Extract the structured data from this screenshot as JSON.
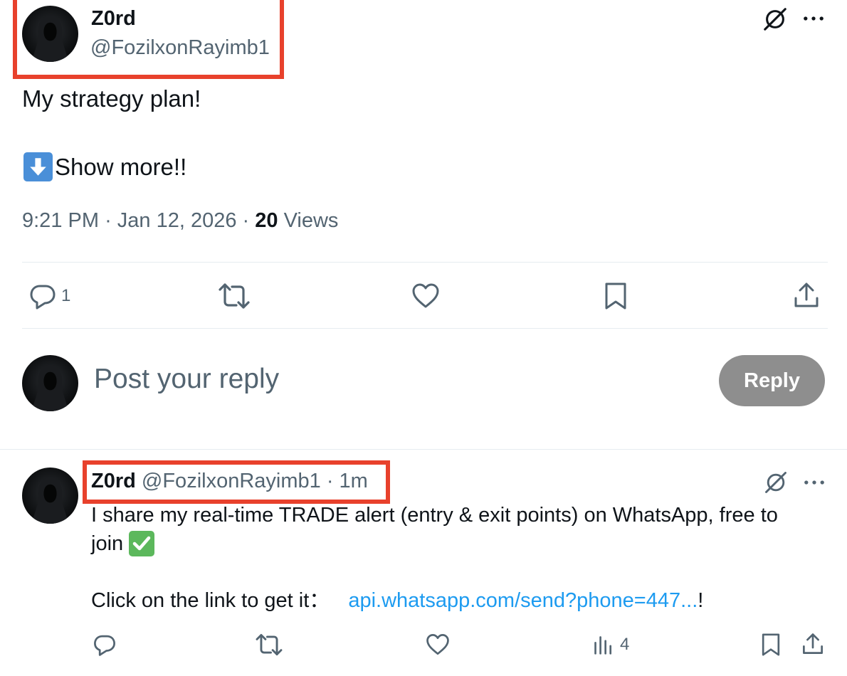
{
  "main_tweet": {
    "author_name": "Z0rd",
    "author_handle": "@FozilxonRayimb1",
    "text_line1": "My strategy plan!",
    "text_line2": "Show more!!",
    "time": "9:21 PM",
    "date": "Jan 12, 2026",
    "views_count": "20",
    "views_label": "Views",
    "reply_count": "1"
  },
  "composer": {
    "placeholder": "Post your reply",
    "reply_button_label": "Reply"
  },
  "reply_tweet": {
    "author_name": "Z0rd",
    "author_handle": "@FozilxonRayimb1",
    "time_ago": "1m",
    "text_line1": "I share my real-time TRADE alert (entry & exit points) on WhatsApp, free to",
    "text_line2": "join",
    "text_line3_prefix": "Click on the link to get it：",
    "link_text": "api.whatsapp.com/send?phone=447...",
    "text_line3_suffix": "!",
    "views_count": "4"
  },
  "icons": {
    "grok": "grok-icon",
    "more": "more-icon",
    "reply": "reply-icon",
    "repost": "repost-icon",
    "like": "like-icon",
    "bookmark": "bookmark-icon",
    "share": "share-icon",
    "views": "views-icon",
    "arrow_down_emoji": "arrow-down-emoji-icon",
    "check_emoji": "check-mark-emoji-icon"
  },
  "colors": {
    "highlight_box": "#e8412c",
    "link": "#1d9bf0",
    "reply_button_disabled": "#8e8e8e",
    "secondary_text": "#536471"
  }
}
